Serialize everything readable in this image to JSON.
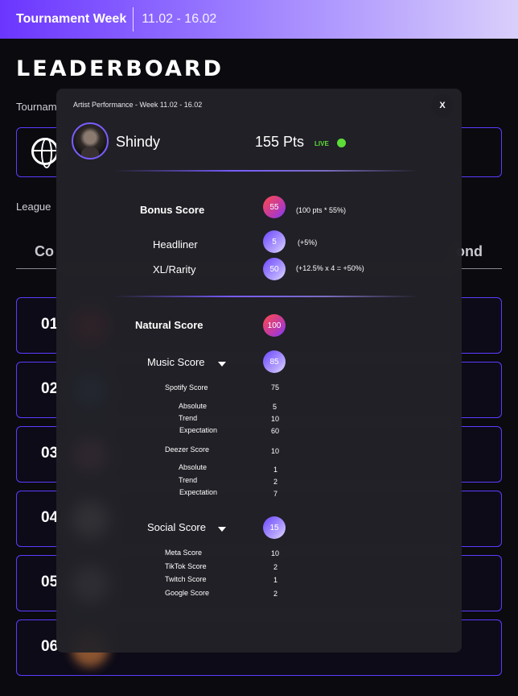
{
  "header": {
    "title": "Tournament Week",
    "dates": "11.02 - 16.02"
  },
  "page": {
    "title": "LEADERBOARD",
    "tournament_label": "Tournam",
    "league_label": "League"
  },
  "tabs": {
    "first": "Co",
    "last": "ond"
  },
  "rows": [
    {
      "rank": "01",
      "color": "#b3202e"
    },
    {
      "rank": "02",
      "color": "#2b5a86"
    },
    {
      "rank": "03",
      "color": "#c25a86"
    },
    {
      "rank": "04",
      "color": "#e8e4e4"
    },
    {
      "rank": "05",
      "color": "#b7b7c2"
    },
    {
      "rank": "06",
      "color": "#8a5430"
    }
  ],
  "modal": {
    "title": "Artist Performance - Week 11.02 - 16.02",
    "close": "X",
    "artist": "Shindy",
    "points": "155 Pts",
    "live": "LIVE",
    "bonus": {
      "label": "Bonus Score",
      "value": "55",
      "note": "(100 pts * 55%)"
    },
    "headliner": {
      "label": "Headliner",
      "value": "5",
      "note": "(+5%)"
    },
    "rarity": {
      "label": "XL/Rarity",
      "value": "50",
      "note": "(+12.5% x 4 = +50%)"
    },
    "natural": {
      "label": "Natural Score",
      "value": "100"
    },
    "music": {
      "label": "Music Score",
      "value": "85",
      "spotify": {
        "label": "Spotify Score",
        "value": "75",
        "absolute": "5",
        "trend": "10",
        "expectation": "60"
      },
      "deezer": {
        "label": "Deezer Score",
        "value": "10",
        "absolute": "1",
        "trend": "2",
        "expectation": "7"
      },
      "sub_labels": {
        "absolute": "Absolute",
        "trend": "Trend",
        "expectation": "Expectation"
      }
    },
    "social": {
      "label": "Social Score",
      "value": "15",
      "items": [
        {
          "label": "Meta Score",
          "value": "10"
        },
        {
          "label": "TikTok Score",
          "value": "2"
        },
        {
          "label": "Twitch Score",
          "value": "1"
        },
        {
          "label": "Google Score",
          "value": "2"
        }
      ]
    }
  }
}
